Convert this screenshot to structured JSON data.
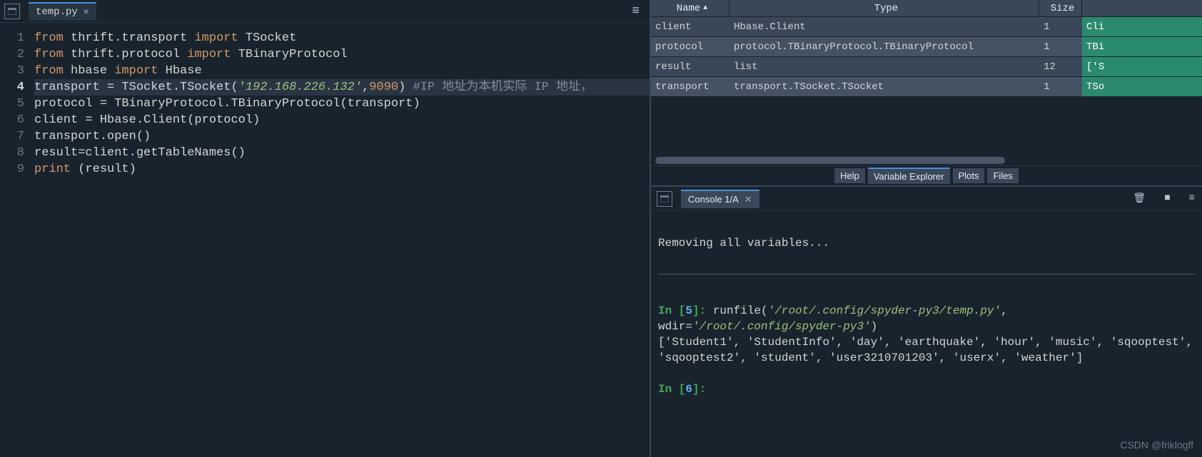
{
  "editor": {
    "tab_label": "temp.py",
    "lines": [
      [
        {
          "t": "from ",
          "c": "kw"
        },
        {
          "t": "thrift.transport "
        },
        {
          "t": "import ",
          "c": "kw"
        },
        {
          "t": "TSocket"
        }
      ],
      [
        {
          "t": "from ",
          "c": "kw"
        },
        {
          "t": "thrift.protocol "
        },
        {
          "t": "import ",
          "c": "kw"
        },
        {
          "t": "TBinaryProtocol"
        }
      ],
      [
        {
          "t": "from ",
          "c": "kw"
        },
        {
          "t": "hbase "
        },
        {
          "t": "import ",
          "c": "kw"
        },
        {
          "t": "Hbase"
        }
      ],
      [
        {
          "t": "transport = TSocket.TSocket("
        },
        {
          "t": "'192.168.226.132'",
          "c": "str"
        },
        {
          "t": ","
        },
        {
          "t": "9090",
          "c": "num"
        },
        {
          "t": ") "
        },
        {
          "t": "#IP 地址为本机实际 IP 地址，",
          "c": "cmt"
        }
      ],
      [
        {
          "t": "protocol = TBinaryProtocol.TBinaryProtocol(transport)"
        }
      ],
      [
        {
          "t": "client = Hbase.Client(protocol)"
        }
      ],
      [
        {
          "t": "transport.open()"
        }
      ],
      [
        {
          "t": "result=client.getTableNames()"
        }
      ],
      [
        {
          "t": "print ",
          "c": "kw"
        },
        {
          "t": "(result)"
        }
      ]
    ],
    "current_line": 4
  },
  "variables": {
    "headers": {
      "name": "Name",
      "type": "Type",
      "size": "Size"
    },
    "rows": [
      {
        "name": "client",
        "type": "Hbase.Client",
        "size": "1",
        "val": "Cli"
      },
      {
        "name": "protocol",
        "type": "protocol.TBinaryProtocol.TBinaryProtocol",
        "size": "1",
        "val": "TBi"
      },
      {
        "name": "result",
        "type": "list",
        "size": "12",
        "val": "['S"
      },
      {
        "name": "transport",
        "type": "transport.TSocket.TSocket",
        "size": "1",
        "val": "TSo"
      }
    ]
  },
  "mid_tabs": {
    "help": "Help",
    "varexp": "Variable Explorer",
    "plots": "Plots",
    "files": "Files"
  },
  "console": {
    "tab_label": "Console 1/A",
    "removing": "Removing all variables...",
    "in5_prefix": "In [",
    "in5_num": "5",
    "in5_suffix": "]: ",
    "runfile_pre": "runfile(",
    "runfile_path": "'/root/.config/spyder-py3/temp.py'",
    "runfile_mid": ", wdir=",
    "runfile_wdir": "'/root/.config/spyder-py3'",
    "runfile_end": ")",
    "output": "['Student1', 'StudentInfo', 'day', 'earthquake', 'hour', 'music', 'sqooptest', 'sqooptest2', 'student', 'user3210701203', 'userx', 'weather']",
    "in6_num": "6",
    "watermark": "CSDN @friklogff"
  }
}
